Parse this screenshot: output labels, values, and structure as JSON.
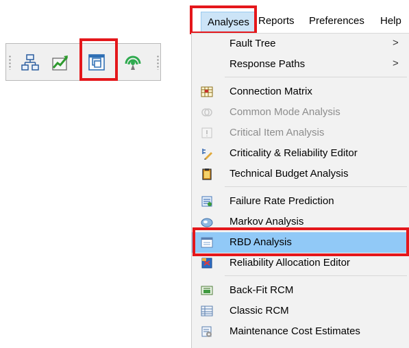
{
  "toolbar": {
    "buttons": [
      {
        "name": "hierarchy-tree-icon"
      },
      {
        "name": "trend-chart-icon"
      },
      {
        "name": "rbd-window-icon",
        "highlighted": true
      },
      {
        "name": "signal-antenna-icon"
      }
    ]
  },
  "menubar": {
    "items": [
      {
        "label": "Analyses",
        "active": true
      },
      {
        "label": "Reports"
      },
      {
        "label": "Preferences"
      },
      {
        "label": "Help"
      }
    ]
  },
  "menu": {
    "items": [
      {
        "label": "Fault Tree",
        "submenu": true,
        "arrow": ">",
        "icon": null
      },
      {
        "label": "Response Paths",
        "submenu": true,
        "arrow": ">",
        "icon": null
      },
      {
        "label": "Connection Matrix",
        "icon": "connection-matrix-icon"
      },
      {
        "label": "Common Mode Analysis",
        "disabled": true,
        "icon": "common-mode-icon"
      },
      {
        "label": "Critical Item Analysis",
        "disabled": true,
        "icon": "critical-item-icon"
      },
      {
        "label": "Criticality & Reliability Editor",
        "icon": "criticality-editor-icon"
      },
      {
        "label": "Technical Budget Analysis",
        "icon": "clipboard-icon"
      },
      {
        "label": "Failure Rate Prediction",
        "icon": "failure-rate-icon"
      },
      {
        "label": "Markov Analysis",
        "icon": "markov-icon"
      },
      {
        "label": "RBD Analysis",
        "selected": true,
        "icon": "rbd-icon"
      },
      {
        "label": "Reliability Allocation Editor",
        "icon": "allocation-editor-icon"
      },
      {
        "label": "Back-Fit RCM",
        "icon": "back-fit-icon"
      },
      {
        "label": "Classic RCM",
        "icon": "classic-rcm-icon"
      },
      {
        "label": "Maintenance Cost Estimates",
        "icon": "maintenance-cost-icon"
      }
    ]
  },
  "colors": {
    "highlight_red": "#e4171b",
    "menu_bg": "#f2f2f2",
    "selected_row": "#91c9f7",
    "active_menu": "#cce4f7",
    "disabled_text": "#8d8d8d"
  }
}
